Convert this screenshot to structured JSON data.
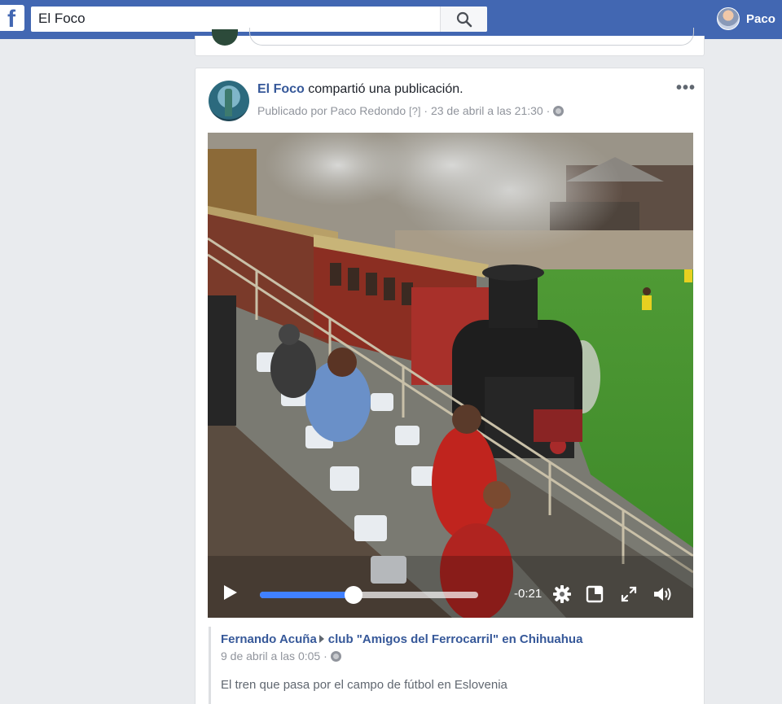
{
  "topbar": {
    "logo": "f",
    "search_value": "El Foco",
    "search_icon": "search-icon",
    "user_name": "Paco",
    "brand_color": "#4267b2"
  },
  "post": {
    "page_name": "El Foco",
    "action_text": " compartió una publicación.",
    "published_by": "Publicado por Paco Redondo",
    "help_mark": "[?]",
    "separator": " · ",
    "date": "23 de abril a las 21:30",
    "privacy_icon": "globe-icon",
    "more_label": "•••"
  },
  "video": {
    "progress": 0.43,
    "time_remaining": "-0:21",
    "icons": [
      "play-icon",
      "settings-icon",
      "miniplayer-icon",
      "fullscreen-icon",
      "volume-icon"
    ]
  },
  "shared": {
    "author": "Fernando Acuña",
    "group": "club \"Amigos del Ferrocarril\" en Chihuahua",
    "date": "9 de abril a las 0:05",
    "separator": " · ",
    "text": "El tren que pasa por el campo de fútbol en Eslovenia"
  }
}
